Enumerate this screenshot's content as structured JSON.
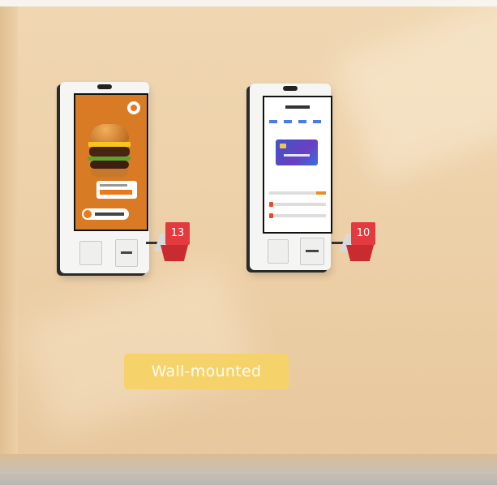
{
  "kiosk_left": {
    "stand_number": "13"
  },
  "kiosk_right": {
    "stand_number": "10"
  },
  "badge": {
    "label": "Wall-mounted"
  },
  "colors": {
    "wall": "#eccfa6",
    "badge": "#f6d26a",
    "stand": "#e23a3e"
  }
}
